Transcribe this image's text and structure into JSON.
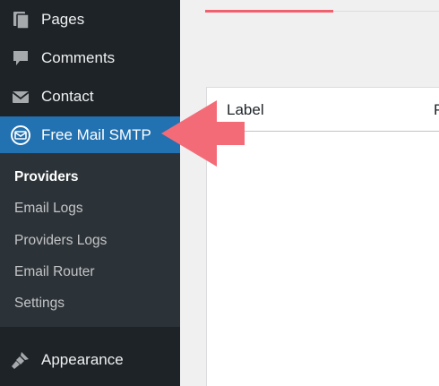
{
  "sidebar": {
    "menu": [
      {
        "label": "Pages",
        "icon": "pages-icon"
      },
      {
        "label": "Comments",
        "icon": "comment-bubble-icon"
      },
      {
        "label": "Contact",
        "icon": "envelope-icon"
      },
      {
        "label": "Free Mail SMTP",
        "icon": "mail-circle-icon",
        "active": true
      }
    ],
    "submenu": [
      {
        "label": "Providers",
        "current": true
      },
      {
        "label": "Email Logs"
      },
      {
        "label": "Providers Logs"
      },
      {
        "label": "Email Router"
      },
      {
        "label": "Settings"
      }
    ],
    "appearance": {
      "label": "Appearance",
      "icon": "paintbrush-icon"
    }
  },
  "main": {
    "table_headers": [
      "Label",
      "P"
    ]
  },
  "colors": {
    "sidebar_bg": "#1d2327",
    "submenu_bg": "#2c3338",
    "active_bg": "#2271b1",
    "accent_red": "#f0606e",
    "arrow": "#f46b78"
  }
}
